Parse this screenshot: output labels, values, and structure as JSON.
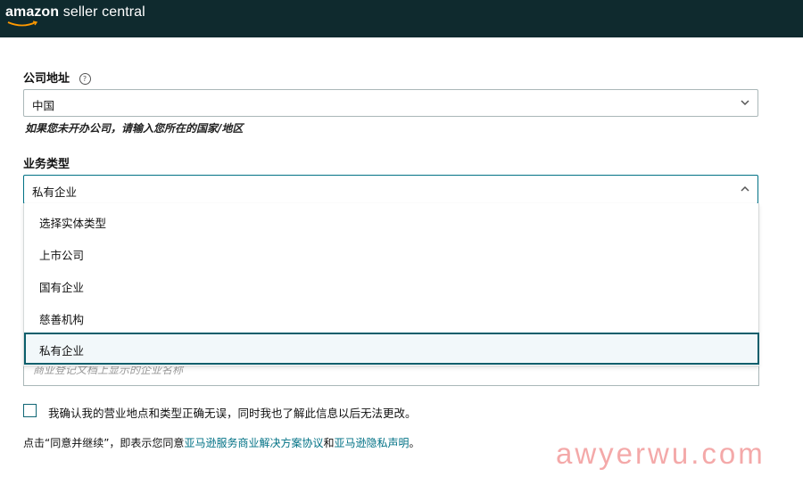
{
  "header": {
    "logo_text_bold": "amazon",
    "logo_text_rest": " seller central"
  },
  "address": {
    "label": "公司地址",
    "help_icon": "?",
    "selected": "中国",
    "hint": "如果您未开办公司，请输入您所在的国家/地区"
  },
  "business_type": {
    "label": "业务类型",
    "selected": "私有企业",
    "options": [
      "选择实体类型",
      "上市公司",
      "国有企业",
      "慈善机构",
      "私有企业"
    ]
  },
  "business_name": {
    "placeholder": "商业登记文档上显示的企业名称"
  },
  "confirm": {
    "label": "我确认我的营业地点和类型正确无误，同时我也了解此信息以后无法更改。"
  },
  "terms": {
    "prefix": "点击“同意并继续”，即表示您同意",
    "link1": "亚马逊服务商业解决方案协议",
    "middle": "和",
    "link2": "亚马逊隐私声明",
    "suffix": "。"
  },
  "watermark": "awyerwu.com",
  "colors": {
    "header_bg": "#0f2a2e",
    "link": "#007185",
    "focus_border": "#0b5e6b"
  }
}
